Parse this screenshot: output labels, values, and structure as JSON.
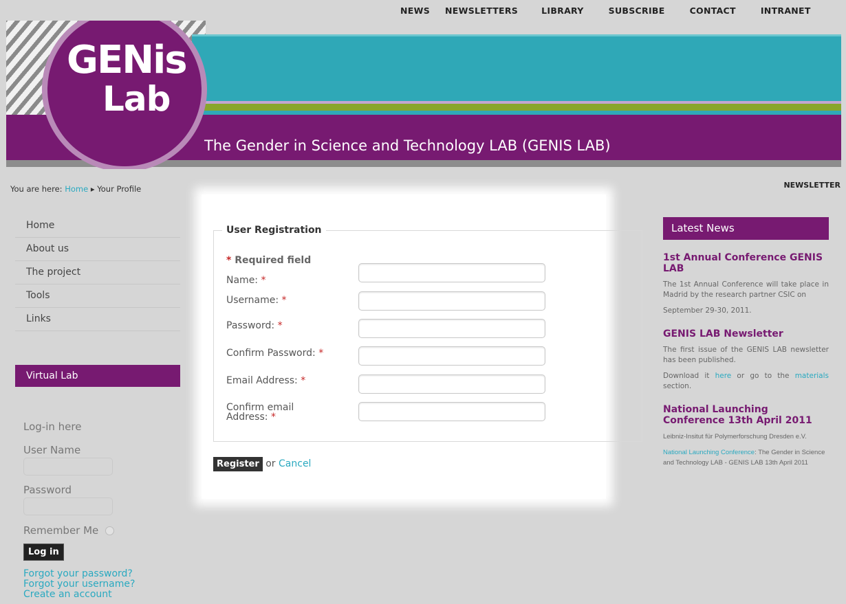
{
  "topnav": [
    "NEWS",
    "NEWSLETTERS",
    "LIBRARY",
    "SUBSCRIBE",
    "CONTACT",
    "INTRANET"
  ],
  "banner": {
    "logo_line1": "GENis",
    "logo_line2": "Lab",
    "title": "The Gender in Science and Technology LAB (GENIS LAB)"
  },
  "breadcrumb": {
    "prefix": "You are here:",
    "home": "Home",
    "separator": "▸",
    "current": "Your Profile"
  },
  "newsletter_link": "NEWSLETTER",
  "leftmenu": [
    "Home",
    "About us",
    "The project",
    "Tools",
    "Links"
  ],
  "virtual_lab": "Virtual Lab",
  "login": {
    "header": "Log-in here",
    "username_label": "User Name",
    "password_label": "Password",
    "remember_label": "Remember Me",
    "button": "Log in",
    "forgot_password": "Forgot your password?",
    "forgot_username": "Forgot your username?",
    "create_account": "Create an account"
  },
  "registration": {
    "legend": "User Registration",
    "required_note": "Required field",
    "star": "*",
    "fields": {
      "name": "Name:",
      "username": "Username:",
      "password": "Password:",
      "confirm_password": "Confirm Password:",
      "email": "Email Address:",
      "confirm_email_1": "Confirm email",
      "confirm_email_2": "Address:"
    },
    "register_button": "Register",
    "or_text": "or",
    "cancel_link": "Cancel"
  },
  "news": {
    "header": "Latest News",
    "item1_title": "1st Annual Conference GENIS LAB",
    "item1_text": "The 1st Annual Conference will take place in Madrid by the research partner CSIC on",
    "item1_date": "September 29-30, 2011.",
    "item2_title": "GENIS LAB Newsletter",
    "item2_text": "The first issue of the GENIS LAB newsletter has been published.",
    "item2_dl_prefix": "Download it",
    "item2_here": "here",
    "item2_mid": "or go to the",
    "item2_materials": "materials",
    "item2_suffix": "section.",
    "item3_title": "National Launching Conference 13th April 2011",
    "item3_text": "Leibniz-Insitut für Polymerforschung Dresden e.V.",
    "item3_link": "National Launching Conference",
    "item3_link_rest": ": The Gender in Science and Technology LAB - GENIS LAB 13th April 2011"
  },
  "colors": {
    "purple": "#771a71",
    "teal": "#2fa8b7",
    "green": "#88a62b",
    "link": "#2aa9c0"
  }
}
